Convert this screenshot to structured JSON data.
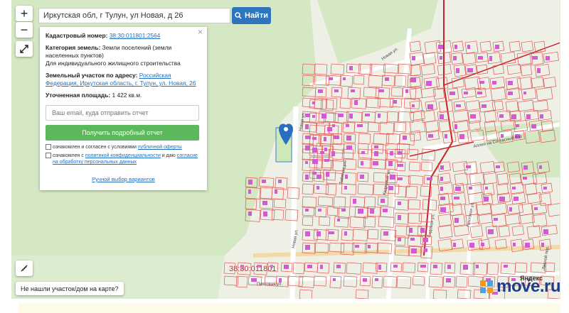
{
  "search": {
    "value": "Иркутская обл, г Тулун, ул Новая, д 26",
    "button_label": "Найти"
  },
  "zoom": {
    "in_label": "+",
    "out_label": "−"
  },
  "info_panel": {
    "cadastral_label": "Кадастровый номер:",
    "cadastral_value": "38:30:011801:2564",
    "category_label": "Категория земель:",
    "category_value": "Земли поселений (земли населенных пунктов)",
    "use_value": "Для индивидуального жилищного строительства",
    "address_label": "Земельный участок по адресу:",
    "address_value": "Российская Федерация, Иркутская область, г. Тулун, ул. Новая, 26",
    "area_label": "Уточненная площадь:",
    "area_value": "1 422 кв.м.",
    "email_placeholder": "Ваш email, куда отправить отчет",
    "report_button": "Получить подробный отчет",
    "consent1_prefix": "ознакомлен и согласен с условиями",
    "consent1_link": "публичной оферты",
    "consent2_prefix": "ознакомлен с",
    "consent2_link1": "политикой конфиденциальности",
    "consent2_mid": "и даю",
    "consent2_link2": "согласие на обработку персональных данных",
    "manual_link": "Ручной выбор вариантов",
    "close": "×"
  },
  "map": {
    "cadastral_block": "38:30:011801",
    "not_found_button": "Не нашли участок/дом на карте?",
    "streets": [
      "Новая ул.",
      "Новая ул.",
      "Таёжная ул.",
      "Кедровый ул.",
      "Садовая ул.",
      "Пихтовая ул.",
      "Пихтовая ул.",
      "Аллея на Согласный бор",
      "Лесной пер."
    ],
    "house_numbers": [
      "35",
      "37",
      "39",
      "41",
      "43",
      "45",
      "47А",
      "2",
      "4",
      "6",
      "8",
      "10",
      "12",
      "14",
      "16",
      "18",
      "20",
      "22",
      "24",
      "25",
      "27",
      "29",
      "31",
      "33",
      "1",
      "3",
      "5",
      "7"
    ],
    "attribution": "Яндекс",
    "colors": {
      "parcel_stroke": "#e05555",
      "building": "#d45ad4",
      "boundary": "#c8232c",
      "forest": "#d6ebc5",
      "field": "#eef0e6"
    }
  },
  "watermark": {
    "text": "move.ru"
  }
}
